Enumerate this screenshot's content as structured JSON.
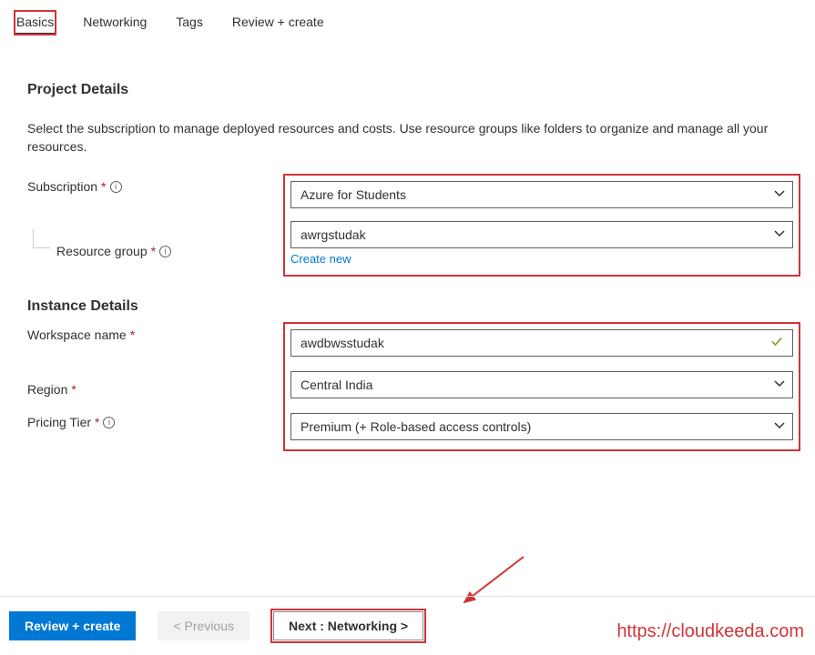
{
  "tabs": {
    "basics": "Basics",
    "networking": "Networking",
    "tags": "Tags",
    "review": "Review + create"
  },
  "project": {
    "heading": "Project Details",
    "description": "Select the subscription to manage deployed resources and costs. Use resource groups like folders to organize and manage all your resources.",
    "subscription_label": "Subscription",
    "subscription_value": "Azure for Students",
    "resource_group_label": "Resource group",
    "resource_group_value": "awrgstudak",
    "create_new": "Create new"
  },
  "instance": {
    "heading": "Instance Details",
    "workspace_label": "Workspace name",
    "workspace_value": "awdbwsstudak",
    "region_label": "Region",
    "region_value": "Central India",
    "pricing_label": "Pricing Tier",
    "pricing_value": "Premium (+ Role-based access controls)"
  },
  "footer": {
    "review": "Review + create",
    "previous": "< Previous",
    "next": "Next : Networking >"
  },
  "watermark": "https://cloudkeeda.com"
}
